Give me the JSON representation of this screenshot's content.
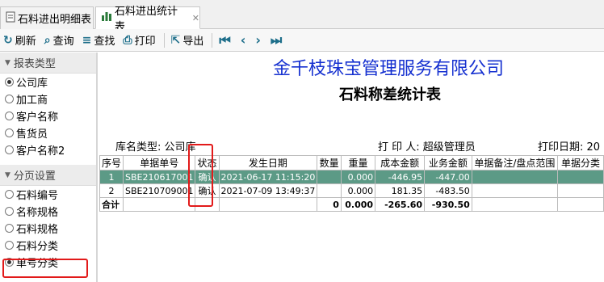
{
  "tabs": [
    {
      "label": "石料进出明细表"
    },
    {
      "label": "石料进出统计表"
    }
  ],
  "toolbar": {
    "refresh": "刷新",
    "query": "查询",
    "find": "查找",
    "print": "打印",
    "export": "导出"
  },
  "sidebar": {
    "report_type": {
      "title": "报表类型",
      "options": [
        "公司库",
        "加工商",
        "客户名称",
        "售货员",
        "客户名称2"
      ],
      "selected": "公司库"
    },
    "paging": {
      "title": "分页设置",
      "options": [
        "石料编号",
        "名称规格",
        "石料规格",
        "石料分类",
        "单号分类"
      ],
      "selected": "单号分类"
    }
  },
  "report": {
    "company": "金千枝珠宝管理服务有限公司",
    "title": "石料称差统计表",
    "meta": {
      "warehouse": "库名类型: 公司库",
      "printer": "打 印 人: 超级管理员",
      "print_date": "打印日期: 20"
    },
    "columns": [
      "序号",
      "单据单号",
      "状态",
      "发生日期",
      "数量",
      "重量",
      "成本金额",
      "业务金额",
      "单据备注/盘点范围",
      "单据分类"
    ],
    "rows": [
      {
        "seq": "1",
        "doc": "SBE210617001",
        "status": "确认",
        "date": "2021-06-17 11:15:20",
        "qty": "",
        "weight": "0.000",
        "cost": "-446.95",
        "amount": "-447.00",
        "note": "",
        "cat": ""
      },
      {
        "seq": "2",
        "doc": "SBE210709001",
        "status": "确认",
        "date": "2021-07-09 13:49:37",
        "qty": "",
        "weight": "0.000",
        "cost": "181.35",
        "amount": "-483.50",
        "note": "",
        "cat": ""
      }
    ],
    "total": {
      "label": "合计",
      "qty": "0",
      "weight": "0.000",
      "cost": "-265.60",
      "amount": "-930.50"
    }
  }
}
